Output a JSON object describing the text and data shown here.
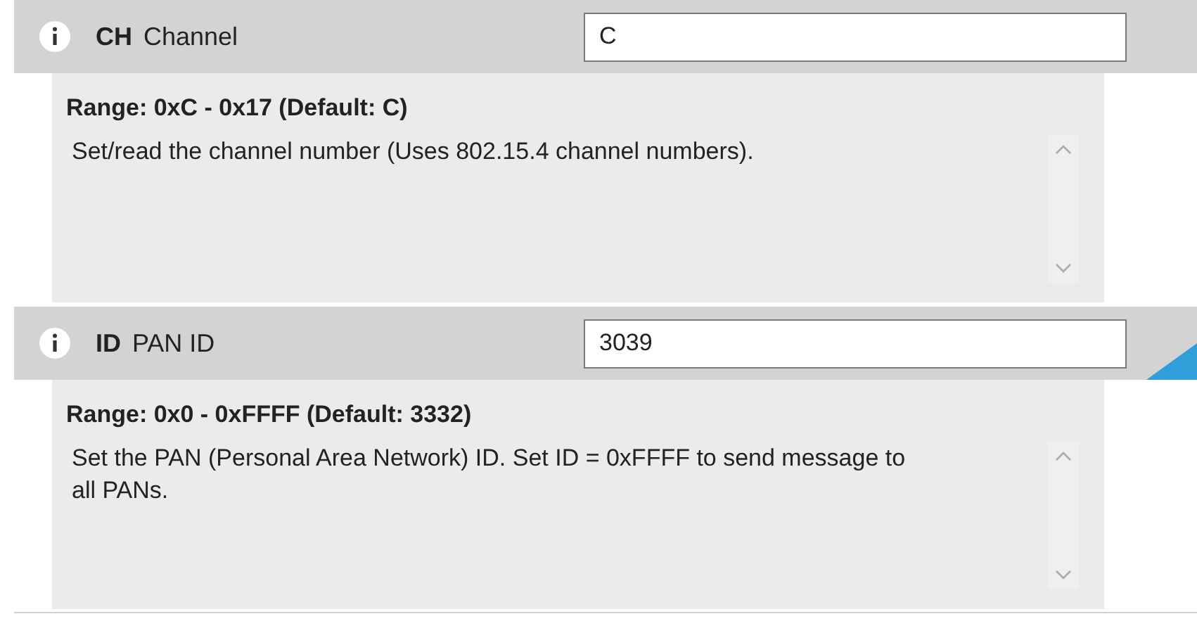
{
  "settings": [
    {
      "code": "CH",
      "name": "Channel",
      "value": "C",
      "modified": false,
      "range": "Range: 0xC - 0x17 (Default: C)",
      "description": "Set/read the channel number (Uses 802.15.4 channel numbers)."
    },
    {
      "code": "ID",
      "name": "PAN ID",
      "value": "3039",
      "modified": true,
      "range": "Range: 0x0 - 0xFFFF (Default: 3332)",
      "description": "Set the PAN (Personal Area Network) ID. Set ID = 0xFFFF to send message to all PANs."
    }
  ]
}
